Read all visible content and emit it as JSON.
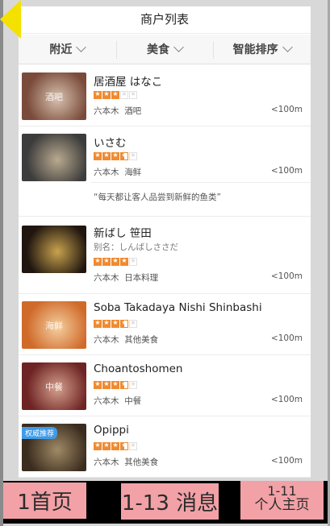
{
  "header": {
    "title": "商户列表"
  },
  "filters": [
    {
      "label": "附近"
    },
    {
      "label": "美食"
    },
    {
      "label": "智能排序"
    }
  ],
  "merchants": [
    {
      "name": "居酒屋 はなこ",
      "thumb_label": "酒吧",
      "rating": 3,
      "area": "六本木",
      "category": "酒吧",
      "distance": "<100m",
      "colors": [
        "#7a4b3a",
        "#d8c2b0"
      ]
    },
    {
      "name": "いさむ",
      "rating": 3.5,
      "area": "六本木",
      "category": "海鲜",
      "distance": "<100m",
      "quote": "“每天都让客人品尝到新鲜的鱼类”",
      "colors": [
        "#3c3c3c",
        "#b9aa8f"
      ]
    },
    {
      "name": "新ばし 笹田",
      "alias": "别名：しんばしささだ",
      "rating": 4,
      "area": "六本木",
      "category": "日本料理",
      "distance": "<100m",
      "colors": [
        "#20160f",
        "#c8a24e"
      ]
    },
    {
      "name": "Soba Takadaya Nishi Shinbashi",
      "thumb_label": "海鲜",
      "rating": 3.5,
      "area": "六本木",
      "category": "其他美食",
      "distance": "<100m",
      "colors": [
        "#d06a2a",
        "#f4cfa0"
      ]
    },
    {
      "name": "Choantoshomen",
      "thumb_label": "中餐",
      "rating": 3.5,
      "area": "六本木",
      "category": "中餐",
      "distance": "<100m",
      "colors": [
        "#6e2424",
        "#d5a08c"
      ]
    },
    {
      "name": "Opippi",
      "tag": "权威推荐",
      "rating": 3.5,
      "area": "六本木",
      "category": "其他美食",
      "distance": "<100m",
      "colors": [
        "#3a2c1e",
        "#a08a66"
      ]
    }
  ],
  "tabbar": {
    "home": "1首页",
    "messages": "1-13 消息",
    "profile_top": "1-11",
    "profile_bottom": "个人主页"
  },
  "colors": {
    "back_arrow": "#f4e100",
    "star": "#f08a30",
    "tab_bg": "#f2a1a6"
  }
}
